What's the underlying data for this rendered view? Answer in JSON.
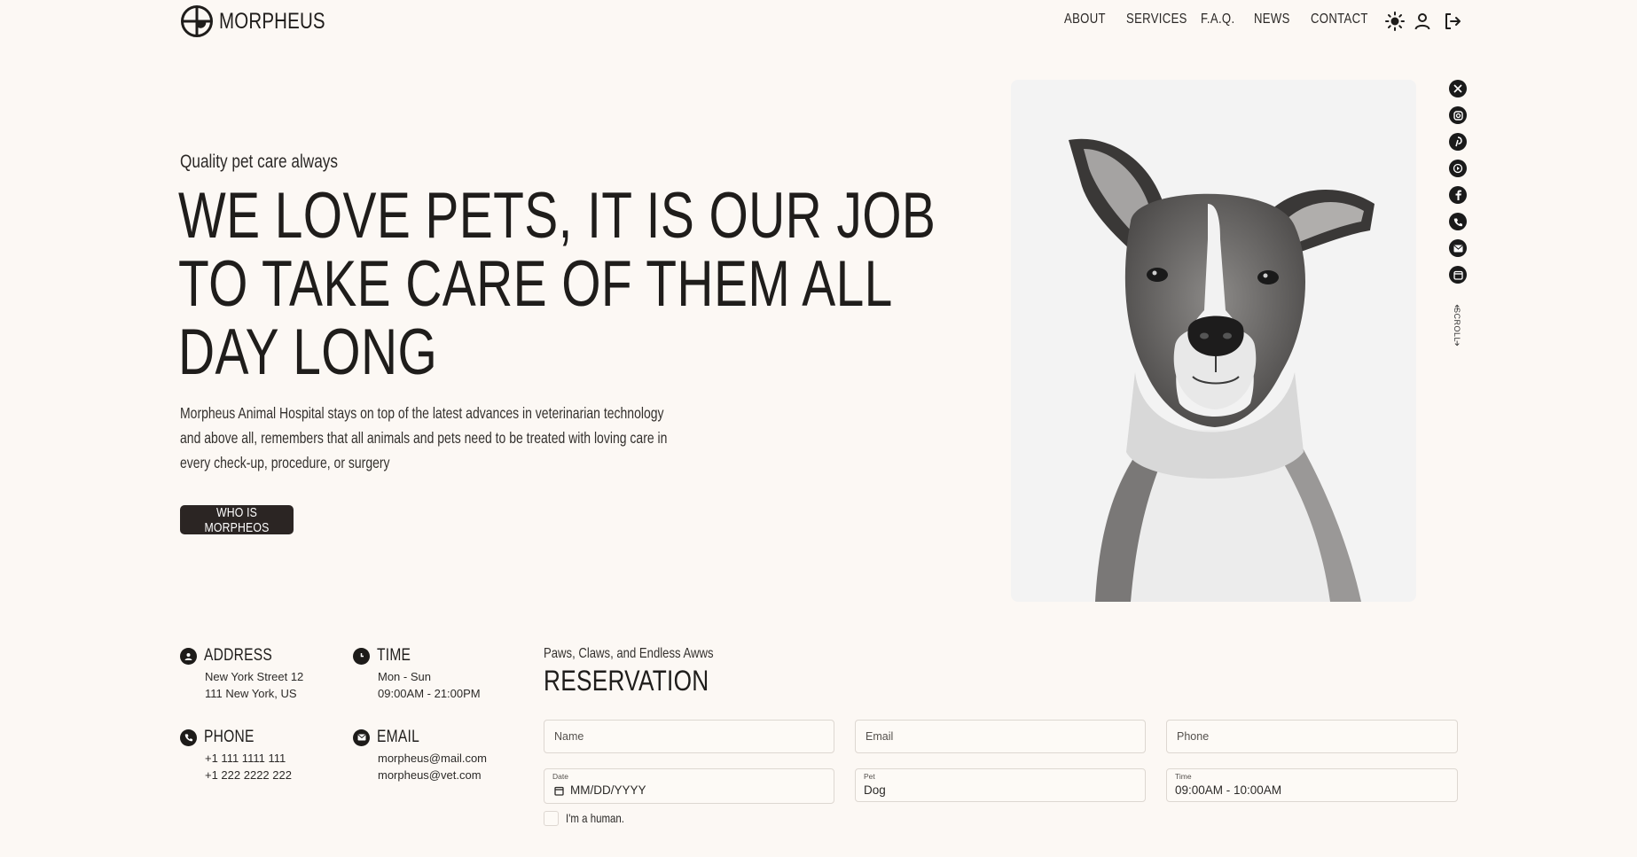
{
  "header": {
    "logo_text": "MORPHEUS",
    "nav": [
      "ABOUT",
      "SERVICES",
      "F.A.Q.",
      "NEWS",
      "CONTACT"
    ],
    "icons": [
      "sun-icon",
      "user-icon",
      "logout-icon"
    ]
  },
  "hero": {
    "tagline": "Quality pet care always",
    "headline": [
      "WE LOVE PETS, IT IS OUR JOB",
      "TO TAKE CARE OF THEM ALL",
      "DAY LONG"
    ],
    "intro": [
      "Morpheus Animal Hospital stays on top of the latest advances in veterinarian technology",
      "and above all, remembers that all animals and pets need to be treated with loving care in",
      "every check-up, procedure, or surgery"
    ],
    "cta_label": "WHO IS MORPHEOS"
  },
  "social": {
    "icons": [
      "x-icon",
      "instagram-icon",
      "pinterest-icon",
      "youtube-icon",
      "facebook-icon",
      "phone-icon",
      "mail-icon",
      "calendar-icon"
    ],
    "scroll_label": "SCROLL"
  },
  "info": {
    "address": {
      "title": "ADDRESS",
      "lines": [
        "New York Street 12",
        "111 New York, US"
      ]
    },
    "time": {
      "title": "TIME",
      "lines": [
        "Mon - Sun",
        "09:00AM - 21:00PM"
      ]
    },
    "phone": {
      "title": "PHONE",
      "lines": [
        "+1 111 1111 111",
        "+1 222 2222 222"
      ]
    },
    "email": {
      "title": "EMAIL",
      "lines": [
        "morpheus@mail.com",
        "morpheus@vet.com"
      ]
    }
  },
  "reservation": {
    "subtitle": "Paws, Claws, and Endless Awws",
    "title": "RESERVATION",
    "name_placeholder": "Name",
    "email_placeholder": "Email",
    "phone_placeholder": "Phone",
    "date_label": "Date",
    "date_value": "MM/DD/YYYY",
    "pet_label": "Pet",
    "pet_value": "Dog",
    "time_label": "Time",
    "time_value": "09:00AM - 10:00AM",
    "human_label": "I'm a human."
  }
}
